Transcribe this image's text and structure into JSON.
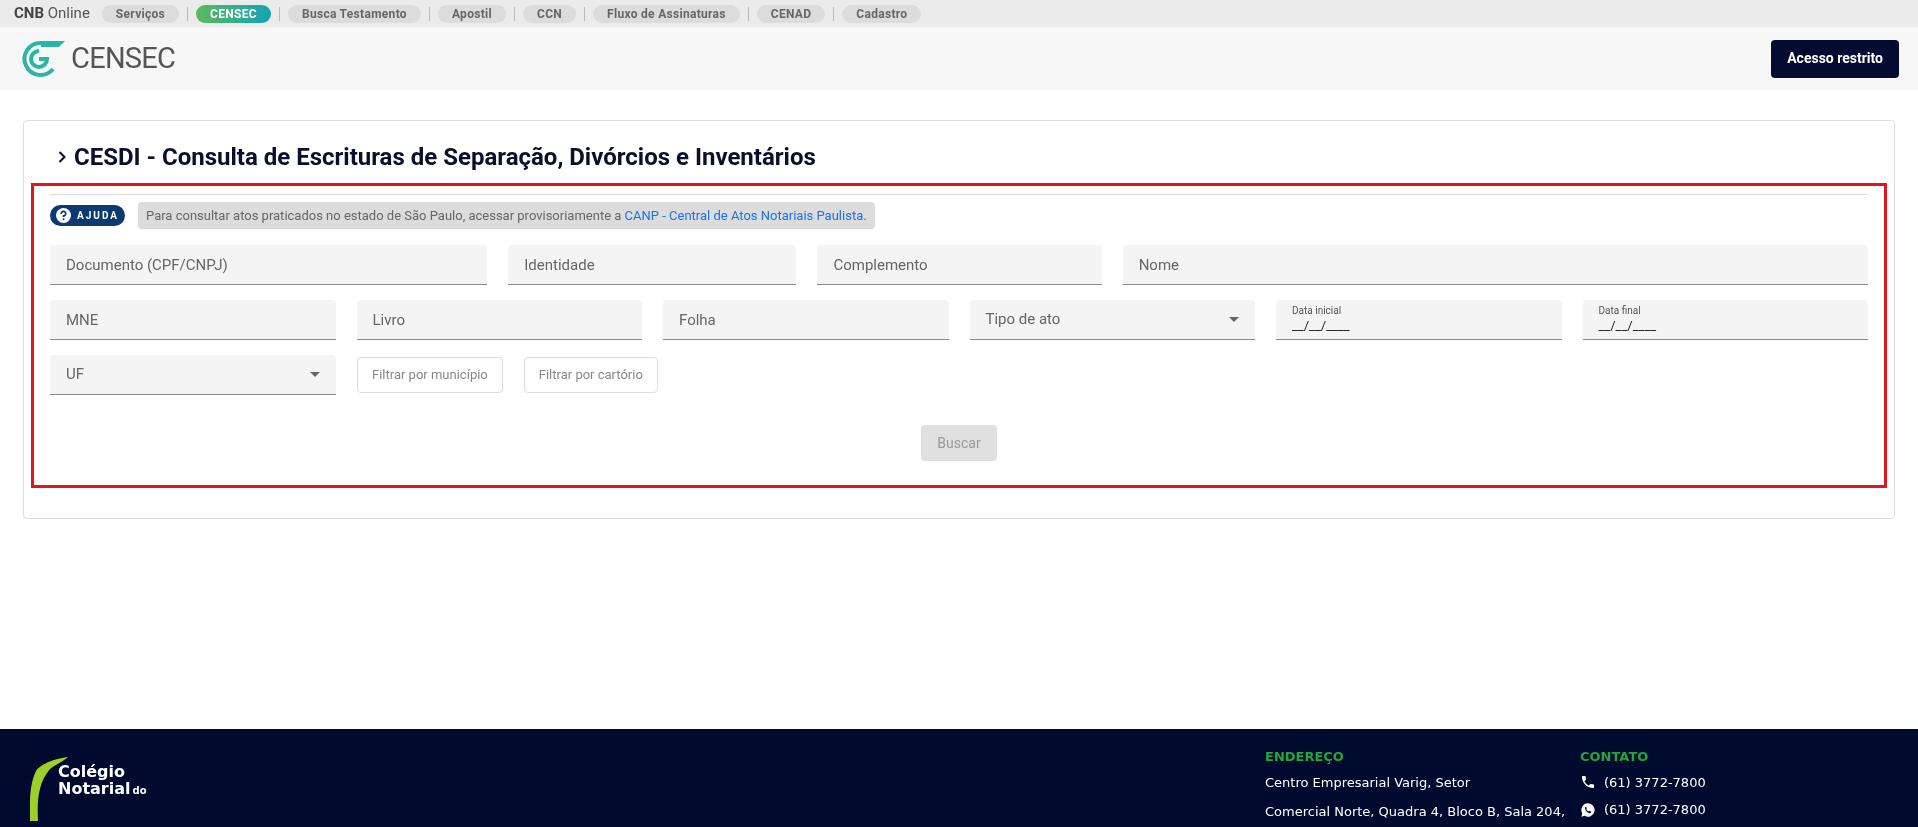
{
  "top_nav": {
    "brand_bold": "CNB",
    "brand": "Online",
    "items": [
      {
        "label": "Serviços",
        "selected": false
      },
      {
        "label": "CENSEC",
        "selected": true
      },
      {
        "label": "Busca Testamento",
        "selected": false
      },
      {
        "label": "Apostil",
        "selected": false
      },
      {
        "label": "CCN",
        "selected": false
      },
      {
        "label": "Fluxo de Assinaturas",
        "selected": false
      },
      {
        "label": "CENAD",
        "selected": false
      },
      {
        "label": "Cadastro",
        "selected": false
      }
    ]
  },
  "header": {
    "logo_text": "CENSEC",
    "button": "Acesso restrito"
  },
  "section": {
    "title": "CESDI - Consulta de Escrituras de Separação, Divórcios e Inventários",
    "help_badge": "AJUDA",
    "notice": {
      "text": "Para consultar atos praticados no estado de São Paulo, acessar provisoriamente a",
      "link": "CANP - Central de Atos Notariais Paulista",
      "end": "."
    },
    "rows": [
      [
        {
          "kind": "text",
          "placeholder": "Documento (CPF/CNPJ)"
        },
        {
          "kind": "text",
          "placeholder": "Identidade"
        },
        {
          "kind": "text",
          "placeholder": "Complemento"
        },
        {
          "kind": "text",
          "placeholder": "Nome"
        }
      ],
      [
        {
          "kind": "text",
          "placeholder": "MNE"
        },
        {
          "kind": "text",
          "placeholder": "Livro"
        },
        {
          "kind": "text",
          "placeholder": "Folha"
        },
        {
          "kind": "select",
          "placeholder": "Tipo de ato"
        },
        {
          "kind": "date",
          "label": "Data inicial",
          "value": "__/__/____"
        },
        {
          "kind": "date",
          "label": "Data final",
          "value": "__/__/____"
        }
      ],
      [
        {
          "kind": "select",
          "placeholder": "UF"
        },
        {
          "kind": "filter",
          "label": "Filtrar por município"
        },
        {
          "kind": "filter",
          "label": "Filtrar por cartório"
        }
      ]
    ],
    "search_button": {
      "label": "Buscar",
      "disabled": true
    }
  },
  "footer": {
    "address": {
      "heading": "ENDEREÇO",
      "lines": [
        "Centro Empresarial Varig, Setor",
        "Comercial Norte, Quadra 4, Bloco B, Sala 204,"
      ]
    },
    "contact": {
      "heading": "CONTATO",
      "items": [
        {
          "kind": "phone",
          "text": "(61) 3772-7800"
        },
        {
          "kind": "whatsapp",
          "text": "(61) 3772-7800"
        }
      ]
    },
    "logo": {
      "line1": "Colégio",
      "line2": "Notarial",
      "line2_small": "do"
    }
  }
}
